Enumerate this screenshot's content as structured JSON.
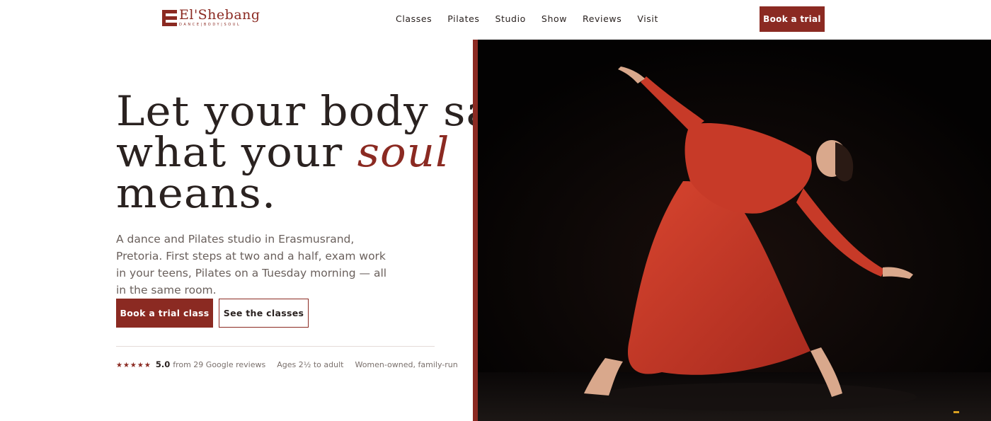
{
  "brand": {
    "name": "El'Shebang",
    "tagline": "DANCE|BODY|SOUL"
  },
  "nav": [
    "Classes",
    "Pilates",
    "Studio",
    "Show",
    "Reviews",
    "Visit"
  ],
  "header_cta": "Book a trial",
  "hero": {
    "headline_line1": "Let your body say",
    "headline_line2_before": "what your ",
    "headline_line2_accent": "soul",
    "headline_line3": "means.",
    "lead": "A dance and Pilates studio in Erasmusrand, Pretoria. First steps at two and a half, exam work in your teens, Pilates on a Tuesday morning — all in the same room.",
    "primary_cta": "Book a trial class",
    "secondary_cta": "See the classes"
  },
  "meta": {
    "stars": "★★★★★",
    "rating": "5.0",
    "reviews": "from 29 Google reviews",
    "ages": "Ages 2½ to adult",
    "ownership": "Women-owned, family-run"
  },
  "colors": {
    "accent": "#8b2a22",
    "text": "#2a2220",
    "muted": "#6a605c",
    "photo_bg": "#050303",
    "dress": "#c83a2a"
  }
}
